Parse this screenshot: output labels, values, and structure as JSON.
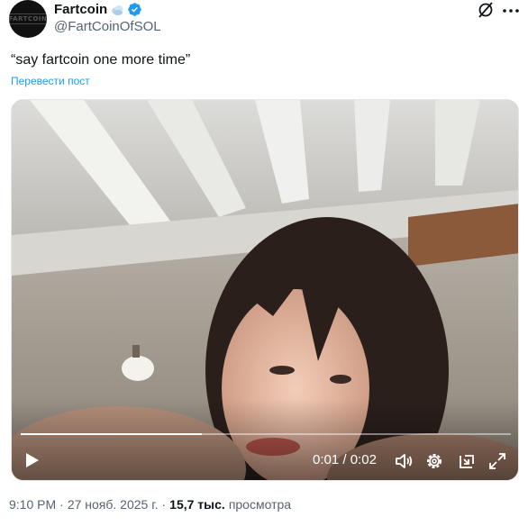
{
  "author": {
    "display_name": "Fartcoin",
    "handle": "@FartCoinOfSOL",
    "avatar_label": "FARTCOIN",
    "verified": true
  },
  "tweet": {
    "text": "“say fartcoin one more time”",
    "translate_label": "Перевести пост"
  },
  "video": {
    "elapsed": "0:01",
    "separator": "/",
    "duration": "0:02",
    "progress": 0.37
  },
  "meta": {
    "time": "9:10 PM",
    "dot1": "·",
    "date": "27 нояб. 2025 г.",
    "dot2": "·",
    "views_count": "15,7 тыс.",
    "views_label": "просмотра"
  },
  "colors": {
    "accent": "#1d9bf0",
    "text": "#0f1419",
    "secondary": "#536471"
  }
}
